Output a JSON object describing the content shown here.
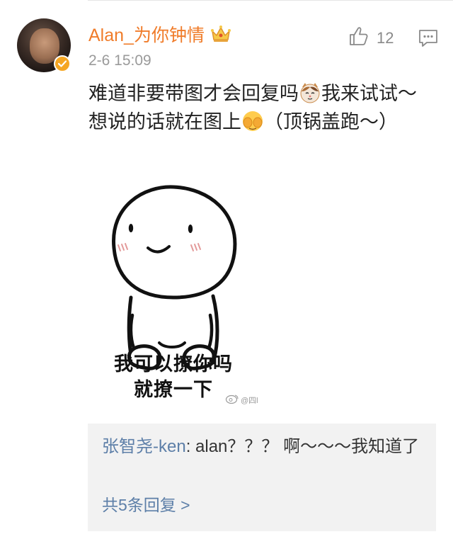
{
  "comment": {
    "username": "Alan_为你钟情",
    "timestamp": "2-6 15:09",
    "like_count": "12",
    "text_part1": "难道非要带图才会回复吗",
    "text_part2": "我来试试～想说的话就在图上",
    "text_part3": "（顶锅盖跑～）",
    "emojis": [
      "cat-emoji",
      "covering-face-emoji"
    ]
  },
  "sticker": {
    "line1": "我可以撩你吗",
    "line2": "就撩一下",
    "watermark": "@四l"
  },
  "reply": {
    "user": "张智尧-ken",
    "separator": ": ",
    "text": "alan？？？ 啊～～～我知道了",
    "more_label": "共5条回复 >"
  },
  "colors": {
    "username": "#f07c2a",
    "link": "#5d7fa8",
    "reply_bg": "#f2f2f2",
    "verified": "#f5a623"
  }
}
